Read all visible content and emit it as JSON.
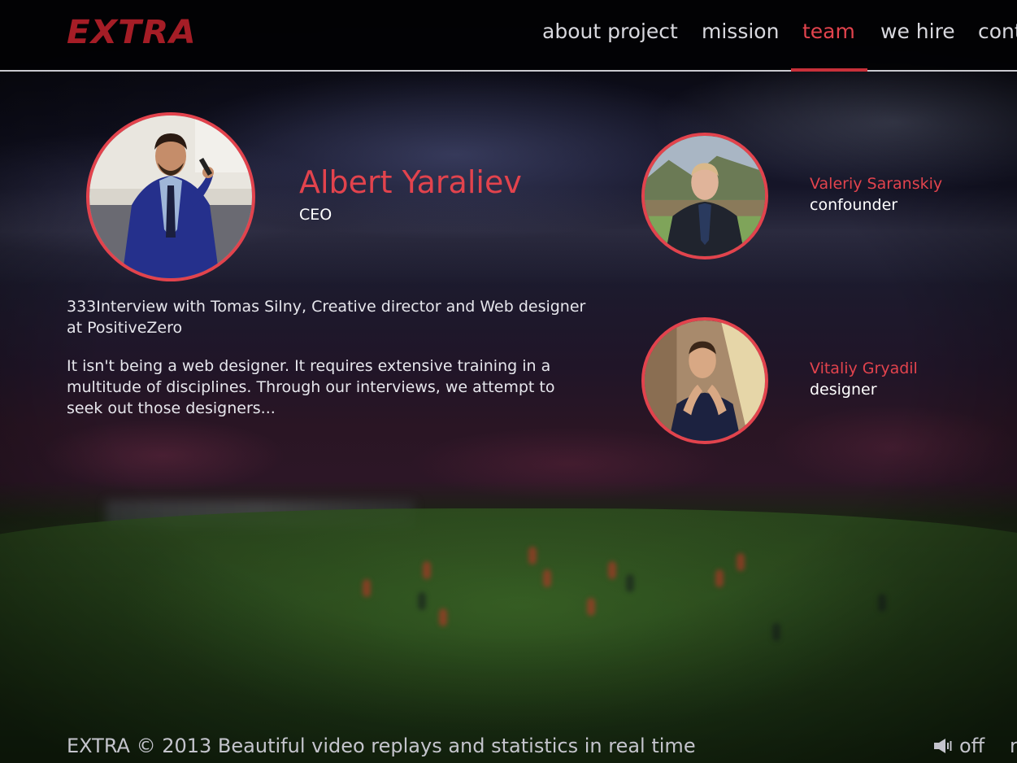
{
  "brand": {
    "logo_text": "EXTRA"
  },
  "nav": {
    "items": [
      {
        "label": "about project",
        "active": false
      },
      {
        "label": "mission",
        "active": false
      },
      {
        "label": "team",
        "active": true
      },
      {
        "label": "we hire",
        "active": false
      },
      {
        "label": "cont",
        "active": false
      }
    ]
  },
  "team": {
    "lead": {
      "name": "Albert Yaraliev",
      "role": "CEO"
    },
    "intro": "333Interview with Tomas Silny, Creative director and Web designer at PositiveZero",
    "description": "It isn't being a web designer. It requires extensive training in a multitude of disciplines. Through our interviews, we attempt to seek out those designers...",
    "members": [
      {
        "name": "Valeriy Saranskiy",
        "role": "confounder"
      },
      {
        "name": "Vitaliy Gryadil",
        "role": "designer"
      }
    ]
  },
  "footer": {
    "text": "EXTRA © 2013 Beautiful video replays and statistics in real time",
    "sound_label": "off",
    "clipped_text": "r"
  },
  "colors": {
    "accent": "#e2434d",
    "logo": "#a51d26",
    "header_bg": "#020204",
    "text": "#ececf2"
  },
  "icons": [
    "speaker-icon"
  ]
}
